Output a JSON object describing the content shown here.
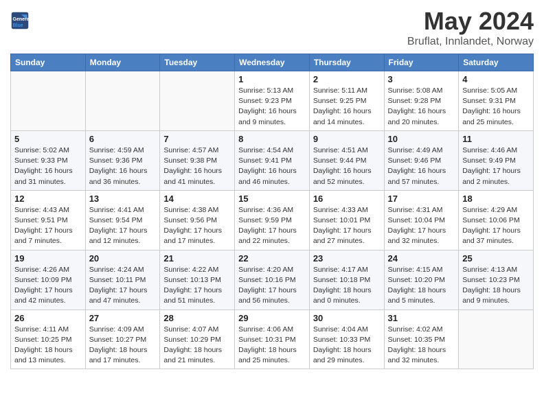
{
  "logo": {
    "line1": "General",
    "line2": "Blue"
  },
  "title": "May 2024",
  "location": "Bruflat, Innlandet, Norway",
  "days_header": [
    "Sunday",
    "Monday",
    "Tuesday",
    "Wednesday",
    "Thursday",
    "Friday",
    "Saturday"
  ],
  "weeks": [
    [
      {
        "day": "",
        "info": ""
      },
      {
        "day": "",
        "info": ""
      },
      {
        "day": "",
        "info": ""
      },
      {
        "day": "1",
        "info": "Sunrise: 5:13 AM\nSunset: 9:23 PM\nDaylight: 16 hours\nand 9 minutes."
      },
      {
        "day": "2",
        "info": "Sunrise: 5:11 AM\nSunset: 9:25 PM\nDaylight: 16 hours\nand 14 minutes."
      },
      {
        "day": "3",
        "info": "Sunrise: 5:08 AM\nSunset: 9:28 PM\nDaylight: 16 hours\nand 20 minutes."
      },
      {
        "day": "4",
        "info": "Sunrise: 5:05 AM\nSunset: 9:31 PM\nDaylight: 16 hours\nand 25 minutes."
      }
    ],
    [
      {
        "day": "5",
        "info": "Sunrise: 5:02 AM\nSunset: 9:33 PM\nDaylight: 16 hours\nand 31 minutes."
      },
      {
        "day": "6",
        "info": "Sunrise: 4:59 AM\nSunset: 9:36 PM\nDaylight: 16 hours\nand 36 minutes."
      },
      {
        "day": "7",
        "info": "Sunrise: 4:57 AM\nSunset: 9:38 PM\nDaylight: 16 hours\nand 41 minutes."
      },
      {
        "day": "8",
        "info": "Sunrise: 4:54 AM\nSunset: 9:41 PM\nDaylight: 16 hours\nand 46 minutes."
      },
      {
        "day": "9",
        "info": "Sunrise: 4:51 AM\nSunset: 9:44 PM\nDaylight: 16 hours\nand 52 minutes."
      },
      {
        "day": "10",
        "info": "Sunrise: 4:49 AM\nSunset: 9:46 PM\nDaylight: 16 hours\nand 57 minutes."
      },
      {
        "day": "11",
        "info": "Sunrise: 4:46 AM\nSunset: 9:49 PM\nDaylight: 17 hours\nand 2 minutes."
      }
    ],
    [
      {
        "day": "12",
        "info": "Sunrise: 4:43 AM\nSunset: 9:51 PM\nDaylight: 17 hours\nand 7 minutes."
      },
      {
        "day": "13",
        "info": "Sunrise: 4:41 AM\nSunset: 9:54 PM\nDaylight: 17 hours\nand 12 minutes."
      },
      {
        "day": "14",
        "info": "Sunrise: 4:38 AM\nSunset: 9:56 PM\nDaylight: 17 hours\nand 17 minutes."
      },
      {
        "day": "15",
        "info": "Sunrise: 4:36 AM\nSunset: 9:59 PM\nDaylight: 17 hours\nand 22 minutes."
      },
      {
        "day": "16",
        "info": "Sunrise: 4:33 AM\nSunset: 10:01 PM\nDaylight: 17 hours\nand 27 minutes."
      },
      {
        "day": "17",
        "info": "Sunrise: 4:31 AM\nSunset: 10:04 PM\nDaylight: 17 hours\nand 32 minutes."
      },
      {
        "day": "18",
        "info": "Sunrise: 4:29 AM\nSunset: 10:06 PM\nDaylight: 17 hours\nand 37 minutes."
      }
    ],
    [
      {
        "day": "19",
        "info": "Sunrise: 4:26 AM\nSunset: 10:09 PM\nDaylight: 17 hours\nand 42 minutes."
      },
      {
        "day": "20",
        "info": "Sunrise: 4:24 AM\nSunset: 10:11 PM\nDaylight: 17 hours\nand 47 minutes."
      },
      {
        "day": "21",
        "info": "Sunrise: 4:22 AM\nSunset: 10:13 PM\nDaylight: 17 hours\nand 51 minutes."
      },
      {
        "day": "22",
        "info": "Sunrise: 4:20 AM\nSunset: 10:16 PM\nDaylight: 17 hours\nand 56 minutes."
      },
      {
        "day": "23",
        "info": "Sunrise: 4:17 AM\nSunset: 10:18 PM\nDaylight: 18 hours\nand 0 minutes."
      },
      {
        "day": "24",
        "info": "Sunrise: 4:15 AM\nSunset: 10:20 PM\nDaylight: 18 hours\nand 5 minutes."
      },
      {
        "day": "25",
        "info": "Sunrise: 4:13 AM\nSunset: 10:23 PM\nDaylight: 18 hours\nand 9 minutes."
      }
    ],
    [
      {
        "day": "26",
        "info": "Sunrise: 4:11 AM\nSunset: 10:25 PM\nDaylight: 18 hours\nand 13 minutes."
      },
      {
        "day": "27",
        "info": "Sunrise: 4:09 AM\nSunset: 10:27 PM\nDaylight: 18 hours\nand 17 minutes."
      },
      {
        "day": "28",
        "info": "Sunrise: 4:07 AM\nSunset: 10:29 PM\nDaylight: 18 hours\nand 21 minutes."
      },
      {
        "day": "29",
        "info": "Sunrise: 4:06 AM\nSunset: 10:31 PM\nDaylight: 18 hours\nand 25 minutes."
      },
      {
        "day": "30",
        "info": "Sunrise: 4:04 AM\nSunset: 10:33 PM\nDaylight: 18 hours\nand 29 minutes."
      },
      {
        "day": "31",
        "info": "Sunrise: 4:02 AM\nSunset: 10:35 PM\nDaylight: 18 hours\nand 32 minutes."
      },
      {
        "day": "",
        "info": ""
      }
    ]
  ]
}
